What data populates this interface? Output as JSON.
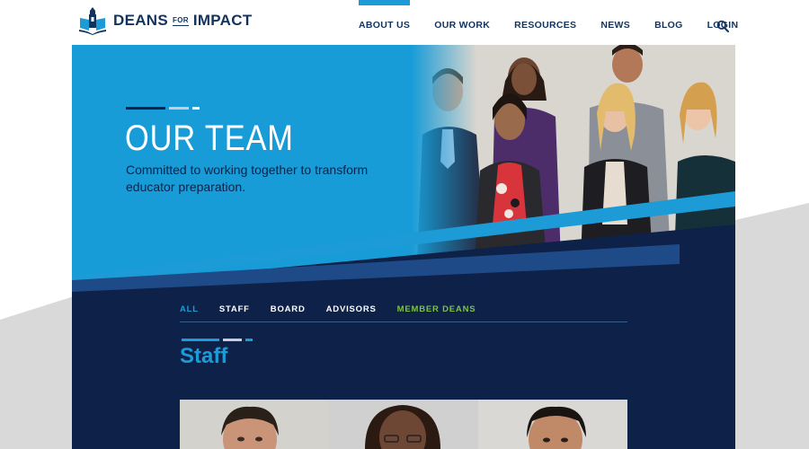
{
  "brand": {
    "name_left": "DEANS",
    "name_for": "FOR",
    "name_right": "IMPACT",
    "logo_icon": "school-book-icon"
  },
  "nav": {
    "items": [
      {
        "label": "ABOUT US",
        "active": true
      },
      {
        "label": "OUR WORK",
        "active": false
      },
      {
        "label": "RESOURCES",
        "active": false
      },
      {
        "label": "NEWS",
        "active": false
      },
      {
        "label": "BLOG",
        "active": false
      },
      {
        "label": "LOGIN",
        "active": false
      }
    ],
    "search_icon": "search-icon"
  },
  "hero": {
    "title": "OUR TEAM",
    "subtitle": "Committed to working together to transform educator preparation."
  },
  "filters": {
    "items": [
      {
        "label": "ALL",
        "active": true
      },
      {
        "label": "STAFF",
        "active": false
      },
      {
        "label": "BOARD",
        "active": false
      },
      {
        "label": "ADVISORS",
        "active": false
      },
      {
        "label": "MEMBER DEANS",
        "active": false
      }
    ]
  },
  "section": {
    "title": "Staff"
  },
  "colors": {
    "brand_navy": "#13335f",
    "accent_blue": "#1c9bd6",
    "dark_navy": "#0d2149",
    "accent_green": "#7dc243"
  }
}
